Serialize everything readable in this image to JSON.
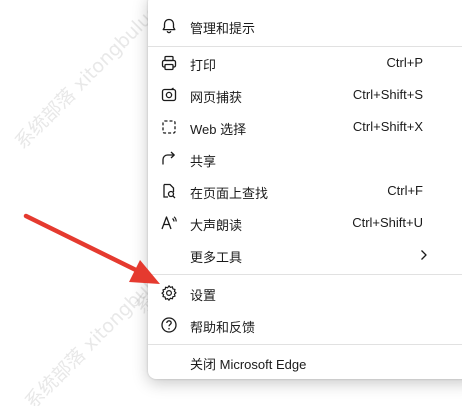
{
  "menu": {
    "items": [
      {
        "label": "管理和提示",
        "shortcut": "",
        "icon": "bell-icon"
      },
      {
        "label": "打印",
        "shortcut": "Ctrl+P",
        "icon": "printer-icon"
      },
      {
        "label": "网页捕获",
        "shortcut": "Ctrl+Shift+S",
        "icon": "web-capture-icon"
      },
      {
        "label": "Web 选择",
        "shortcut": "Ctrl+Shift+X",
        "icon": "web-select-icon"
      },
      {
        "label": "共享",
        "shortcut": "",
        "icon": "share-icon"
      },
      {
        "label": "在页面上查找",
        "shortcut": "Ctrl+F",
        "icon": "find-on-page-icon"
      },
      {
        "label": "大声朗读",
        "shortcut": "Ctrl+Shift+U",
        "icon": "read-aloud-icon"
      },
      {
        "label": "更多工具",
        "shortcut": "",
        "icon": "more-tools-icon"
      },
      {
        "label": "设置",
        "shortcut": "",
        "icon": "gear-icon"
      },
      {
        "label": "帮助和反馈",
        "shortcut": "",
        "icon": "help-icon"
      },
      {
        "label": "关闭 Microsoft Edge",
        "shortcut": "",
        "icon": ""
      }
    ]
  },
  "watermark": {
    "text": "系统部落 xitongbuluo.com"
  },
  "colors": {
    "arrow": "#e53a2f",
    "text": "#1b1b1b",
    "separator": "#e1e1e1"
  }
}
